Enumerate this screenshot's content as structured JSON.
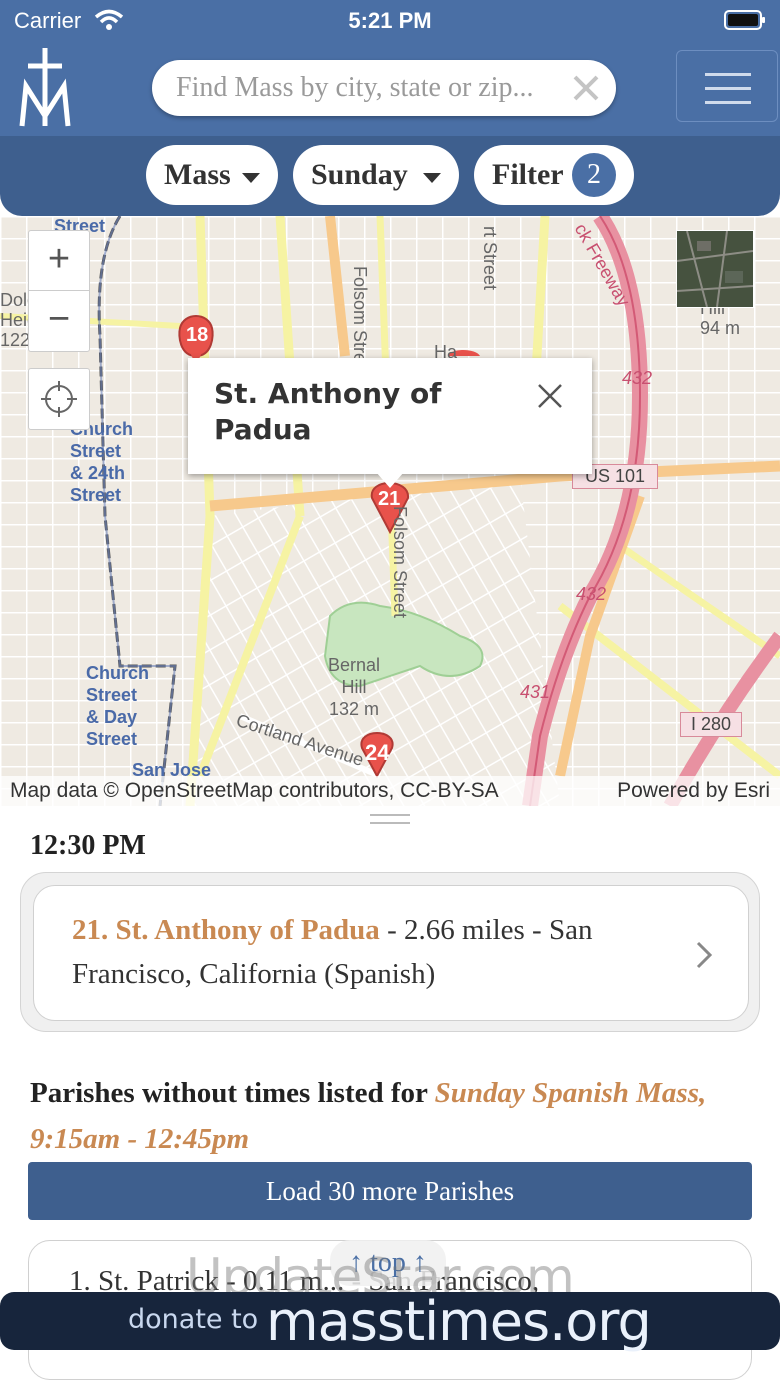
{
  "status_bar": {
    "carrier": "Carrier",
    "time": "5:21 PM"
  },
  "header": {
    "search_placeholder": "Find Mass by city, state or zip..."
  },
  "filter_bar": {
    "type_label": "Mass",
    "day_label": "Sunday",
    "filter_label": "Filter",
    "filter_count": "2"
  },
  "map": {
    "popup_title": "St. Anthony of Padua",
    "attribution_left": "Map data © OpenStreetMap contributors, CC-BY-SA",
    "attribution_right": "Powered by Esri",
    "markers": [
      "18",
      "21",
      "24"
    ],
    "labels": {
      "folsom_top": "Folsom Street",
      "folsom_mid": "Folsom Street",
      "street_top": "Street",
      "street_right": "rt Street",
      "freeway": "ck Freeway",
      "church_24th": [
        "Church",
        "Street",
        "& 24th",
        "Street"
      ],
      "church_day": [
        "Church",
        "Street",
        "& Day",
        "Street"
      ],
      "san_jose": "San Jose",
      "bernal_hill": [
        "Bernal",
        "Hill",
        "132 m"
      ],
      "cortland": "Cortland Avenue",
      "hill_94": [
        "Hill",
        "94 m"
      ],
      "route_432_a": "432",
      "route_432_b": "432",
      "route_431": "431",
      "us101": "US 101",
      "i280": "I 280",
      "dolo": [
        "Dolo",
        "Heig",
        "122"
      ],
      "ha": "Ha"
    },
    "colors": {
      "freeway": "#e891a1",
      "primary": "#f7c98c",
      "secondary": "#f6f3a3",
      "park": "#c8e6bf",
      "marker": "#e8524b"
    }
  },
  "results": {
    "time_heading": "12:30 PM",
    "first": {
      "name": "21. St. Anthony of Padua",
      "detail": " - 2.66 miles - San Francisco, California (Spanish)"
    },
    "parishes_heading_prefix": "Parishes without times listed for ",
    "parishes_heading_accent": "Sunday Spanish Mass, 9:15am - 12:45pm",
    "load_more_label": "Load 30 more Parishes",
    "next_card_text": "1. St. Patrick - 0.11 m... - San Francisco,"
  },
  "overlays": {
    "top_link": "↑ top ↑",
    "watermark": "UpdateStar.com",
    "donate_small": "donate to",
    "donate_big": "masstimes.org"
  }
}
